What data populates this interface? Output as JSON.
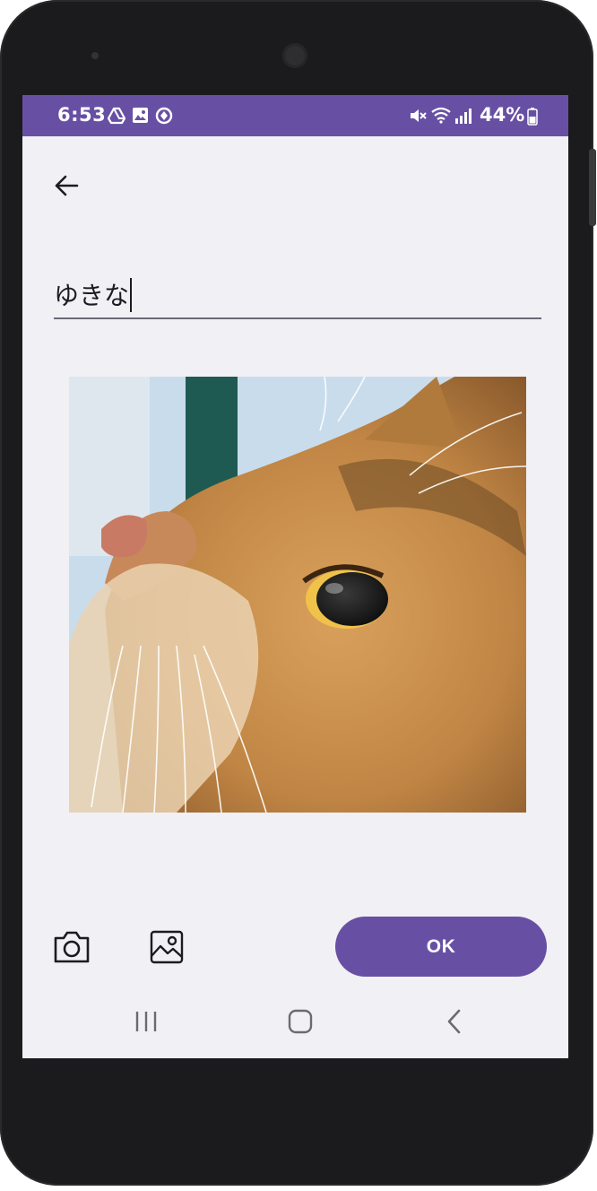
{
  "status_bar": {
    "time": "6:53",
    "battery": "44%",
    "left_icons": [
      "drive-icon",
      "gallery-icon",
      "sync-icon"
    ],
    "right_icons": [
      "mute-icon",
      "wifi-icon",
      "signal-icon",
      "battery-icon"
    ]
  },
  "header": {
    "back_icon": "arrow-left-icon"
  },
  "name_field": {
    "value": "ゆきな"
  },
  "photo": {
    "subject": "cat-photo"
  },
  "toolbar": {
    "camera_icon": "camera-icon",
    "gallery_icon": "image-icon",
    "ok_label": "OK"
  },
  "nav": {
    "icons": [
      "recents-icon",
      "home-icon",
      "back-icon"
    ]
  },
  "colors": {
    "accent": "#6750a4",
    "background": "#f1f0f4",
    "text": "#1c1b1f"
  }
}
